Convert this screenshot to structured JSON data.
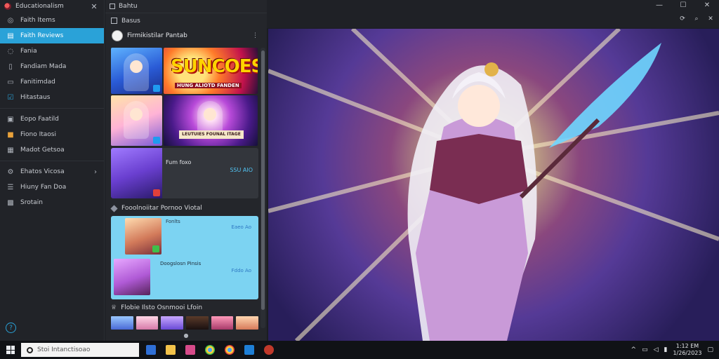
{
  "window": {
    "app_title": "Educationalism",
    "viewer_title": "Bahtu"
  },
  "sidebar": {
    "items": [
      {
        "label": "Faith Items",
        "icon": "circle-icon",
        "active": false
      },
      {
        "label": "Faith Reviews",
        "icon": "book-icon",
        "active": true
      },
      {
        "label": "Fania",
        "icon": "chat-icon",
        "active": false
      },
      {
        "label": "Fandiam Mada",
        "icon": "doc-icon",
        "active": false
      },
      {
        "label": "Fanitimdad",
        "icon": "folder-icon",
        "active": false
      },
      {
        "label": "Hitastaus",
        "icon": "check-icon",
        "active": false
      },
      {
        "label": "Eopo Faatild",
        "icon": "image-icon",
        "active": false
      },
      {
        "label": "Fiono Itaosi",
        "icon": "app-icon",
        "active": false
      },
      {
        "label": "Madot Getsoa",
        "icon": "calendar-icon",
        "active": false
      },
      {
        "label": "Ehatos Vicosa",
        "icon": "gear-icon",
        "active": false
      },
      {
        "label": "Hiuny Fan Doa",
        "icon": "people-icon",
        "active": false
      },
      {
        "label": "Srotain",
        "icon": "grid-icon",
        "active": false
      }
    ]
  },
  "panel": {
    "top_title": "Basus",
    "featured_title": "Firmikistilar Pantab",
    "tile_big_text": "SUNCOES",
    "tile_strip_text": "HUNG ALIOTD FANDEN",
    "tile_strip2_text": "LEUTUIES FOUNAL ITAGE",
    "promo_name": "Fum foxo",
    "promo_price": "SSU AIO",
    "section1_title": "Fooolnoiitar Pornoo Viotal",
    "lb_rows": [
      {
        "label": "Fonlts",
        "value": "Eaeo Ao"
      },
      {
        "label": "Doogslosn Pinsis",
        "value": "Fddo Ao"
      }
    ],
    "section2_title": "Flobie Ilsto Osnmooi Lfoin",
    "foot_label": "●"
  },
  "taskbar": {
    "search_placeholder": "Stoi Intanctisoao",
    "clock_time": "1:12 EM",
    "clock_date": "1/26/2023"
  },
  "colors": {
    "accent": "#2aa2d8",
    "sidebar_bg": "#212328",
    "panel_bg": "#24262b"
  }
}
